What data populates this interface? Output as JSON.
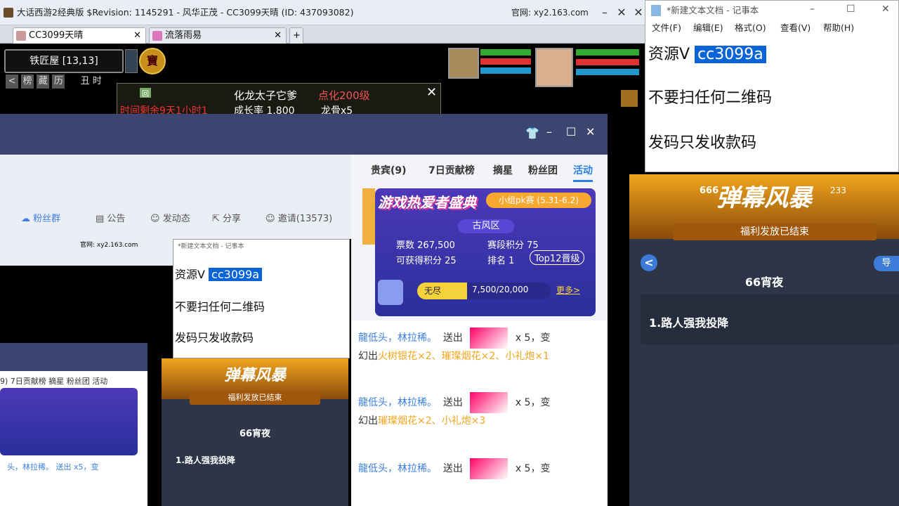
{
  "game_window": {
    "title": "大话西游2经典版 $Revision: 1145291 - 风华正茂 - CC3099天晴 (ID: 437093082)",
    "official_site": "官网: xy2.163.com",
    "tabs": [
      {
        "label": "CC3099天晴"
      },
      {
        "label": "流落雨易"
      }
    ],
    "location": "铁匠屋 [13,13]",
    "time_label": "丑 时",
    "toolbar_buttons": [
      "榜",
      "藏",
      "历"
    ],
    "notice": {
      "text1": "化龙太子它爹",
      "text2": "点化200级",
      "text3": "时间剩余9天1小时1",
      "text4": "成长率 1.800",
      "text5": "龙骨x5"
    }
  },
  "live_window": {
    "toolbar": {
      "fans": "粉丝群",
      "announce": "公告",
      "post": "发动态",
      "share": "分享",
      "invite": "邀请(13573)"
    },
    "side_tabs": [
      "贵宾(9)",
      "7日贡献榜",
      "摘星",
      "粉丝团",
      "活动"
    ],
    "active_tab": "活动",
    "event_banner": {
      "title": "游戏热爱者盛典",
      "group_pk": "小组pk赛 (5.31-6.2)",
      "region": "古风区",
      "votes_label": "票数",
      "votes_value": "267,500",
      "score_label": "赛段积分",
      "score_value": "75",
      "gain_label": "可获得积分",
      "gain_value": "25",
      "rank_label": "排名",
      "rank_value": "1",
      "badge": "Top12晋级",
      "level": "无尽",
      "progress": "7,500/20,000",
      "progress_fraction": 0.375,
      "more": "更多>"
    },
    "feed": [
      {
        "user": "龍低头，林拉稀。",
        "action": "送出",
        "count": "x 5，变",
        "result_prefix": "幻出",
        "result": "火树银花×2、璀璨烟花×2、小礼炮×1"
      },
      {
        "user": "龍低头，林拉稀。",
        "action": "送出",
        "count": "x 5，变",
        "result_prefix": "幻出",
        "result": "璀璨烟花×2、小礼炮×3"
      },
      {
        "user": "龍低头，林拉稀。",
        "action": "送出",
        "count": "x 5，变",
        "result_prefix": "",
        "result": ""
      }
    ]
  },
  "notepad": {
    "title": "*新建文本文档 - 记事本",
    "menu": [
      "文件(F)",
      "编辑(E)",
      "格式(O)",
      "查看(V)",
      "帮助(H)"
    ],
    "line1_prefix": "资源V",
    "line1_selected": "cc3099a",
    "line2": "不要扫任何二维码",
    "line3": "发码只发收款码"
  },
  "danmu_panel": {
    "count": "666",
    "title": "弹幕风暴",
    "count_small": "233",
    "banner": "福利发放已结束",
    "back": "<",
    "download": "导",
    "event_name": "66宵夜",
    "item1": "1.路人强我投降"
  },
  "colors": {
    "accent": "#3c7cd8",
    "selection": "#0a64d6",
    "header": "#3b4570",
    "orange": "#f0a51c"
  }
}
